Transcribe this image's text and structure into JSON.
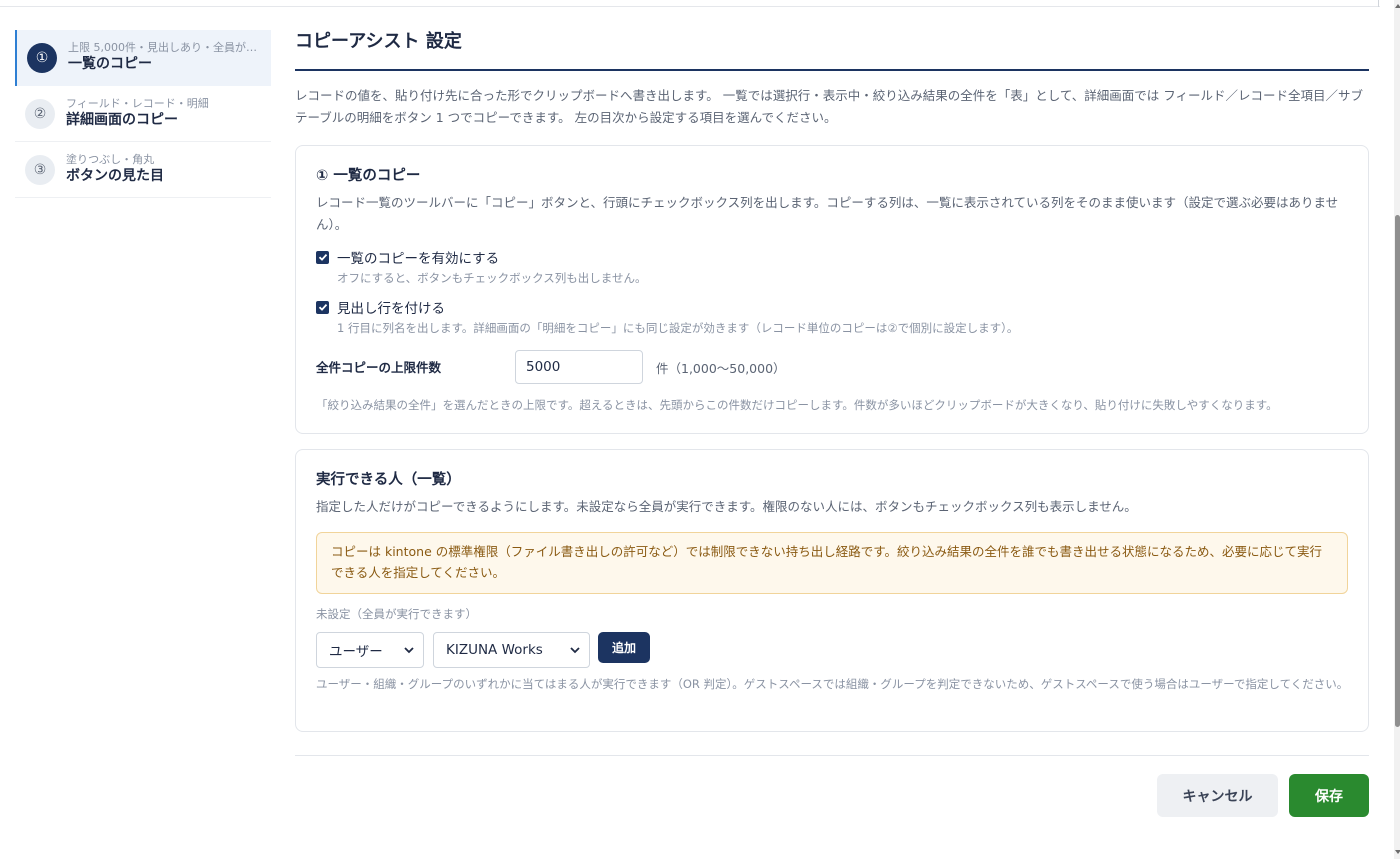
{
  "nav": {
    "items": [
      {
        "num": "①",
        "sub": "上限 5,000件・見出しあり・全員が…",
        "title": "一覧のコピー",
        "active": true
      },
      {
        "num": "②",
        "sub": "フィールド・レコード・明細",
        "title": "詳細画面のコピー",
        "active": false
      },
      {
        "num": "③",
        "sub": "塗りつぶし・角丸",
        "title": "ボタンの見た目",
        "active": false
      }
    ]
  },
  "page": {
    "title": "コピーアシスト 設定",
    "intro": "レコードの値を、貼り付け先に合った形でクリップボードへ書き出します。 一覧では選択行・表示中・絞り込み結果の全件を「表」として、詳細画面では フィールド／レコード全項目／サブテーブルの明細をボタン 1 つでコピーできます。 左の目次から設定する項目を選んでください。"
  },
  "list_copy": {
    "title": "① 一覧のコピー",
    "desc": "レコード一覧のツールバーに「コピー」ボタンと、行頭にチェックボックス列を出します。コピーする列は、一覧に表示されている列をそのまま使います（設定で選ぶ必要はありません）。",
    "enable_label": "一覧のコピーを有効にする",
    "enable_checked": true,
    "enable_help": "オフにすると、ボタンもチェックボックス列も出しません。",
    "header_label": "見出し行を付ける",
    "header_checked": true,
    "header_help": "1 行目に列名を出します。詳細画面の「明細をコピー」にも同じ設定が効きます（レコード単位のコピーは②で個別に設定します）。",
    "limit_label": "全件コピーの上限件数",
    "limit_value": "5000",
    "limit_unit": "件（1,000〜50,000）",
    "limit_help": "「絞り込み結果の全件」を選んだときの上限です。超えるときは、先頭からこの件数だけコピーします。件数が多いほどクリップボードが大きくなり、貼り付けに失敗しやすくなります。"
  },
  "executors": {
    "title": "実行できる人（一覧）",
    "desc": "指定した人だけがコピーできるようにします。未設定なら全員が実行できます。権限のない人には、ボタンもチェックボックス列も表示しません。",
    "warning": "コピーは kintone の標準権限（ファイル書き出しの許可など）では制限できない持ち出し経路です。絞り込み結果の全件を誰でも書き出せる状態になるため、必要に応じて実行できる人を指定してください。",
    "unset_text": "未設定（全員が実行できます）",
    "type_select": "ユーザー",
    "user_select": "KIZUNA Works",
    "add_label": "追加",
    "help": "ユーザー・組織・グループのいずれかに当てはまる人が実行できます（OR 判定）。ゲストスペースでは組織・グループを判定できないため、ゲストスペースで使う場合はユーザーで指定してください。"
  },
  "footer": {
    "cancel_label": "キャンセル",
    "save_label": "保存"
  },
  "colors": {
    "accent": "#1c3461",
    "active_border": "#2e7fd3",
    "save": "#2a8a2f",
    "warning_bg": "#fef8ec",
    "warning_border": "#f1d49a"
  }
}
